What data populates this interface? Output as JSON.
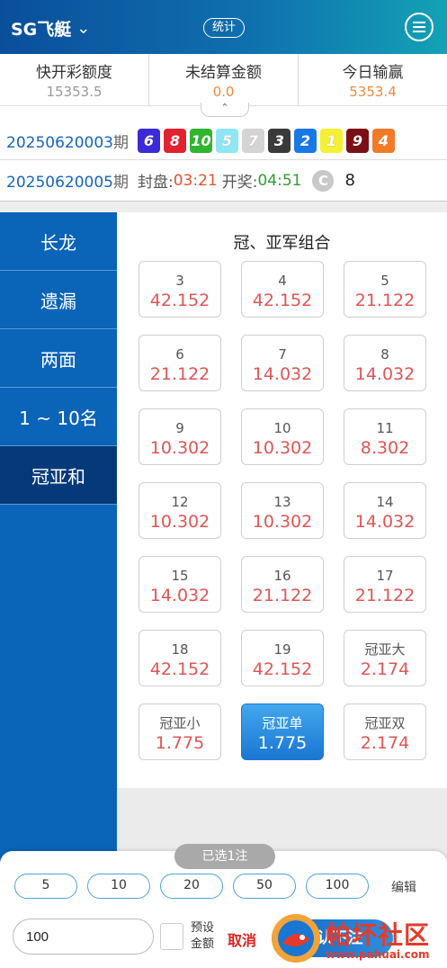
{
  "header": {
    "title": "SG飞艇",
    "stats_label": "统计"
  },
  "summary": [
    {
      "label": "快开彩额度",
      "value": "15353.5"
    },
    {
      "label": "未结算金额",
      "value": "0.0"
    },
    {
      "label": "今日输赢",
      "value": "5353.4"
    }
  ],
  "last_draw": {
    "period": "20250620003",
    "period_suffix": "期",
    "balls": [
      {
        "n": "6",
        "color": "#3b2ad6"
      },
      {
        "n": "8",
        "color": "#e3222f"
      },
      {
        "n": "10",
        "color": "#2fb52f"
      },
      {
        "n": "5",
        "color": "#8fe6f3"
      },
      {
        "n": "7",
        "color": "#d4d4d4"
      },
      {
        "n": "3",
        "color": "#3a3a3a"
      },
      {
        "n": "2",
        "color": "#1a78e6"
      },
      {
        "n": "1",
        "color": "#f4f033"
      },
      {
        "n": "9",
        "color": "#7a0f16"
      },
      {
        "n": "4",
        "color": "#f27a28"
      }
    ]
  },
  "next_draw": {
    "period": "20250620005",
    "period_suffix": "期",
    "close_label": "封盘:",
    "close_time": "03:21",
    "open_label": "开奖:",
    "open_time": "04:51",
    "count": "8"
  },
  "sidebar": [
    {
      "label": "长龙"
    },
    {
      "label": "遗漏"
    },
    {
      "label": "两面"
    },
    {
      "label": "1 ~ 10名"
    },
    {
      "label": "冠亚和"
    }
  ],
  "panel": {
    "title": "冠、亚军组合",
    "cells": [
      {
        "name": "3",
        "odds": "42.152"
      },
      {
        "name": "4",
        "odds": "42.152"
      },
      {
        "name": "5",
        "odds": "21.122"
      },
      {
        "name": "6",
        "odds": "21.122"
      },
      {
        "name": "7",
        "odds": "14.032"
      },
      {
        "name": "8",
        "odds": "14.032"
      },
      {
        "name": "9",
        "odds": "10.302"
      },
      {
        "name": "10",
        "odds": "10.302"
      },
      {
        "name": "11",
        "odds": "8.302"
      },
      {
        "name": "12",
        "odds": "10.302"
      },
      {
        "name": "13",
        "odds": "10.302"
      },
      {
        "name": "14",
        "odds": "14.032"
      },
      {
        "name": "15",
        "odds": "14.032"
      },
      {
        "name": "16",
        "odds": "21.122"
      },
      {
        "name": "17",
        "odds": "21.122"
      },
      {
        "name": "18",
        "odds": "42.152"
      },
      {
        "name": "19",
        "odds": "42.152"
      },
      {
        "name": "冠亚大",
        "odds": "2.174"
      },
      {
        "name": "冠亚小",
        "odds": "1.775"
      },
      {
        "name": "冠亚单",
        "odds": "1.775"
      },
      {
        "name": "冠亚双",
        "odds": "2.174"
      }
    ]
  },
  "bet": {
    "selected_label": "已选1注",
    "chips": [
      "5",
      "10",
      "20",
      "50",
      "100"
    ],
    "edit_label": "编辑",
    "amount": "100",
    "preset_line1": "预设",
    "preset_line2": "金额",
    "cancel_label": "取消",
    "confirm_label": "确认下注"
  },
  "watermark": {
    "text": "帕坏社区",
    "url": "www.pahuai.com"
  }
}
